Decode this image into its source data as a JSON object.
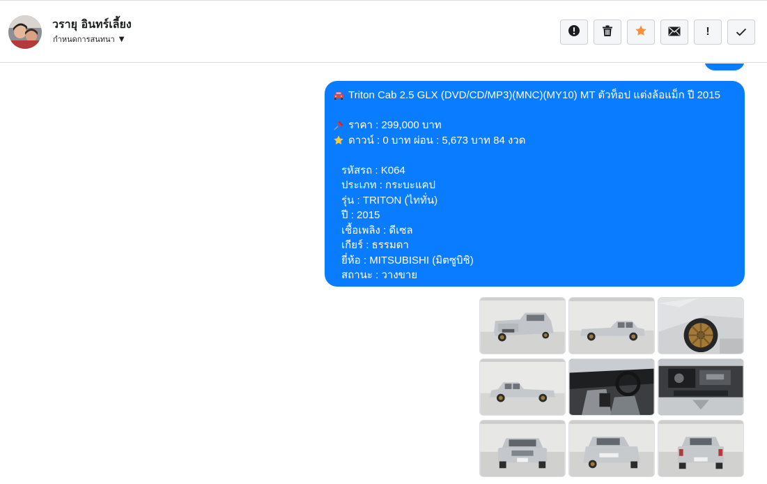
{
  "header": {
    "contact_name": "วรายุ อินทร์เลี้ยง",
    "status_label": "กำหนดการสนทนา",
    "actions": [
      {
        "name": "spam-button",
        "icon": "alert-circle-icon"
      },
      {
        "name": "delete-button",
        "icon": "trash-icon"
      },
      {
        "name": "star-button",
        "icon": "star-icon",
        "color": "#f7923b"
      },
      {
        "name": "mark-unread-button",
        "icon": "envelope-icon"
      },
      {
        "name": "important-button",
        "icon": "exclamation-icon"
      },
      {
        "name": "mark-done-button",
        "icon": "check-icon"
      }
    ]
  },
  "message": {
    "title": "Triton Cab 2.5 GLX (DVD/CD/MP3)(MNC)(MY10) MT ตัวท็อป แต่งล้อแม็ก ปี 2015",
    "price": "ราคา : 299,000 บาท",
    "down": "ดาวน์ : 0 บาท ผ่อน : 5,673 บาท 84 งวด",
    "details": [
      "รหัสรถ : K064",
      "ประเภท : กระบะแคป",
      "รุ่น : TRITON (ไททั่น)",
      "ปี : 2015",
      "เชื้อเพลิง : ดีเซล",
      "เกียร์ : ธรรมดา",
      "ยี่ห้อ : MITSUBISHI (มิตซูบิชิ)",
      "สถานะ : วางขาย"
    ],
    "bubble_color": "#0a7cff",
    "text_color": "#ffffff"
  },
  "photos": [
    {
      "name": "car-photo-rear-left",
      "view": "rear-quarter"
    },
    {
      "name": "car-photo-side-left",
      "view": "side"
    },
    {
      "name": "car-photo-wheel",
      "view": "wheel"
    },
    {
      "name": "car-photo-side-right",
      "view": "side"
    },
    {
      "name": "car-photo-interior",
      "view": "interior"
    },
    {
      "name": "car-photo-engine",
      "view": "engine"
    },
    {
      "name": "car-photo-front",
      "view": "front"
    },
    {
      "name": "car-photo-rear-quarter",
      "view": "rear-quarter"
    },
    {
      "name": "car-photo-rear",
      "view": "rear"
    }
  ]
}
